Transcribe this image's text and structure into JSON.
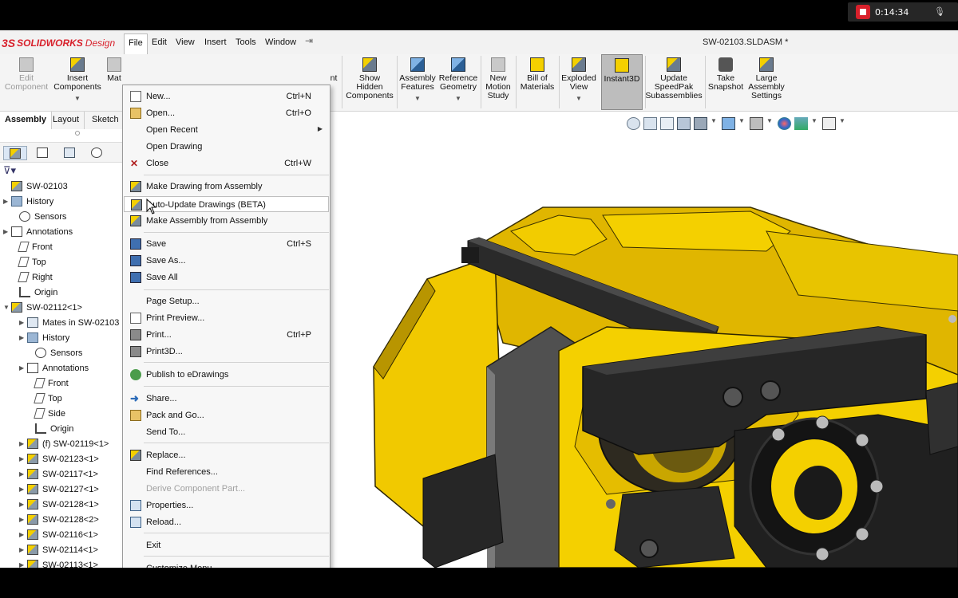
{
  "recording": {
    "time": "0:14:34"
  },
  "app": {
    "logo_mark": "3S",
    "logo_brand": "SOLIDWORKS",
    "logo_sub": "Design",
    "document_title": "SW-02103.SLDASM *"
  },
  "menubar": [
    "File",
    "Edit",
    "View",
    "Insert",
    "Tools",
    "Window"
  ],
  "commands": [
    {
      "label1": "Edit",
      "label2": "Component"
    },
    {
      "label1": "Insert",
      "label2": "Components"
    },
    {
      "label1": "Mat"
    },
    {
      "label1": "nt"
    },
    {
      "label1": "Show",
      "label2": "Hidden",
      "label3": "Components"
    },
    {
      "label1": "Assembly",
      "label2": "Features"
    },
    {
      "label1": "Reference",
      "label2": "Geometry"
    },
    {
      "label1": "New",
      "label2": "Motion",
      "label3": "Study"
    },
    {
      "label1": "Bill of",
      "label2": "Materials"
    },
    {
      "label1": "Exploded",
      "label2": "View"
    },
    {
      "label1": "Instant3D"
    },
    {
      "label1": "Update",
      "label2": "SpeedPak",
      "label3": "Subassemblies"
    },
    {
      "label1": "Take",
      "label2": "Snapshot"
    },
    {
      "label1": "Large",
      "label2": "Assembly",
      "label3": "Settings"
    }
  ],
  "tabs": [
    "Assembly",
    "Layout",
    "Sketch"
  ],
  "tree": [
    {
      "label": "SW-02103"
    },
    {
      "label": "History"
    },
    {
      "label": "Sensors"
    },
    {
      "label": "Annotations"
    },
    {
      "label": "Front"
    },
    {
      "label": "Top"
    },
    {
      "label": "Right"
    },
    {
      "label": "Origin"
    },
    {
      "label": "SW-02112<1>"
    },
    {
      "label": "Mates in SW-02103"
    },
    {
      "label": "History"
    },
    {
      "label": "Sensors"
    },
    {
      "label": "Annotations"
    },
    {
      "label": "Front"
    },
    {
      "label": "Top"
    },
    {
      "label": "Side"
    },
    {
      "label": "Origin"
    },
    {
      "label": "(f) SW-02119<1>"
    },
    {
      "label": "SW-02123<1>"
    },
    {
      "label": "SW-02117<1>"
    },
    {
      "label": "SW-02127<1>"
    },
    {
      "label": "SW-02128<1>"
    },
    {
      "label": "SW-02128<2>"
    },
    {
      "label": "SW-02116<1>"
    },
    {
      "label": "SW-02114<1>"
    },
    {
      "label": "SW-02113<1>"
    }
  ],
  "file_menu": [
    {
      "label": "New...",
      "shortcut": "Ctrl+N"
    },
    {
      "label": "Open...",
      "shortcut": "Ctrl+O"
    },
    {
      "label": "Open Recent",
      "shortcut": ""
    },
    {
      "label": "Open Drawing",
      "shortcut": ""
    },
    {
      "label": "Close",
      "shortcut": "Ctrl+W"
    },
    {
      "label": "Make Drawing from Assembly",
      "shortcut": ""
    },
    {
      "label": "Auto-Update Drawings (BETA)",
      "shortcut": ""
    },
    {
      "label": "Make Assembly from Assembly",
      "shortcut": ""
    },
    {
      "label": "Save",
      "shortcut": "Ctrl+S"
    },
    {
      "label": "Save As...",
      "shortcut": ""
    },
    {
      "label": "Save All",
      "shortcut": ""
    },
    {
      "label": "Page Setup...",
      "shortcut": ""
    },
    {
      "label": "Print Preview...",
      "shortcut": ""
    },
    {
      "label": "Print...",
      "shortcut": "Ctrl+P"
    },
    {
      "label": "Print3D...",
      "shortcut": ""
    },
    {
      "label": "Publish to eDrawings",
      "shortcut": ""
    },
    {
      "label": "Share...",
      "shortcut": ""
    },
    {
      "label": "Pack and Go...",
      "shortcut": ""
    },
    {
      "label": "Send To...",
      "shortcut": ""
    },
    {
      "label": "Replace...",
      "shortcut": ""
    },
    {
      "label": "Find References...",
      "shortcut": ""
    },
    {
      "label": "Derive Component Part...",
      "shortcut": ""
    },
    {
      "label": "Properties...",
      "shortcut": ""
    },
    {
      "label": "Reload...",
      "shortcut": ""
    },
    {
      "label": "Exit",
      "shortcut": ""
    },
    {
      "label": "Customize Menu",
      "shortcut": ""
    }
  ]
}
